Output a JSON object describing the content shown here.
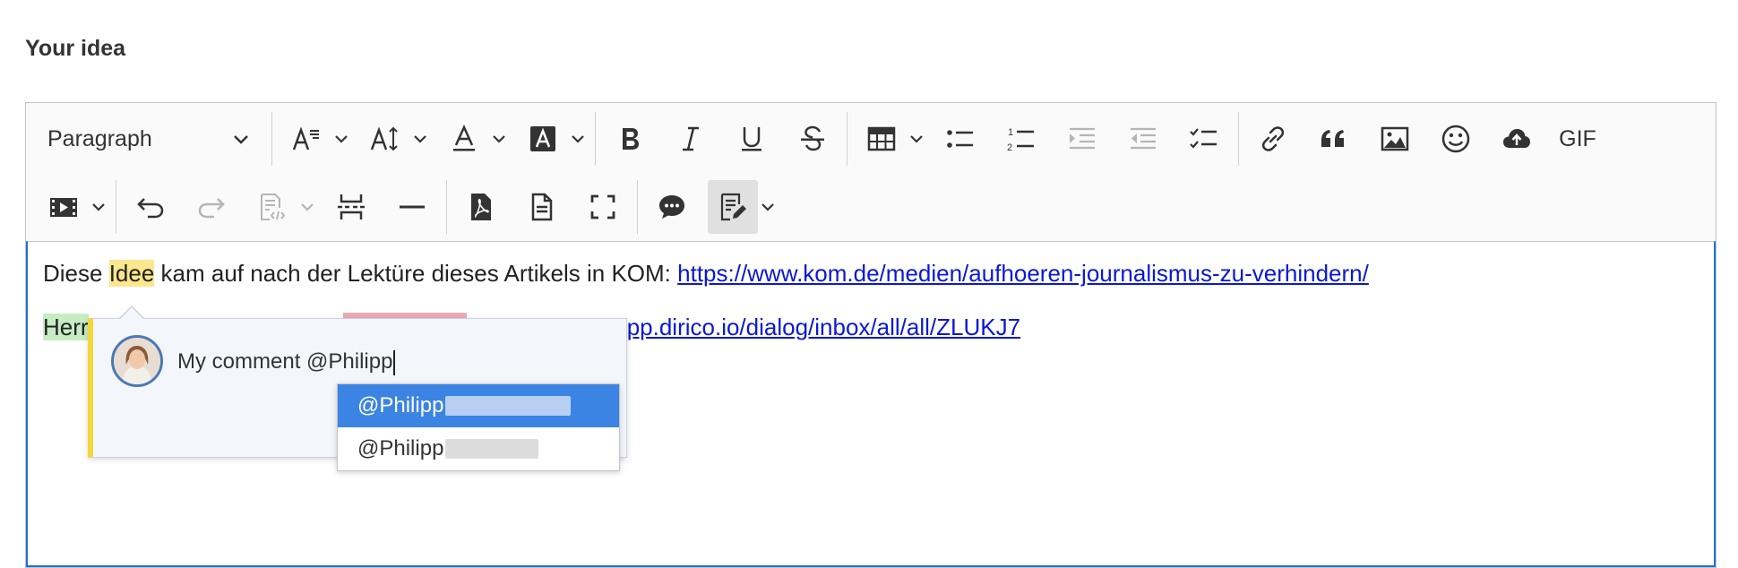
{
  "label": "Your idea",
  "toolbar": {
    "heading": "Paragraph",
    "gif": "GIF"
  },
  "content": {
    "p1_a": "Diese ",
    "p1_b": "Idee",
    "p1_c": " kam auf nach der Lektüre dieses Artikels in KOM: ",
    "p1_link": "https://www.kom.de/medien/aufhoeren-journalismus-zu-verhindern/",
    "p2_a": "Herr",
    "p2_link": "s://app.dirico.io/dialog/inbox/all/all/ZLUKJ7"
  },
  "comment": {
    "input": "My comment @Philipp"
  },
  "mentions": [
    "@Philipp",
    "@Philipp"
  ],
  "colors": {
    "accent": "#3b84e3",
    "focus_border": "#1d6fd6",
    "highlight_yellow": "#fbe78d",
    "highlight_green": "#c7ecc2",
    "highlight_pink": "#e9a9b5",
    "link": "#0a18d6"
  }
}
